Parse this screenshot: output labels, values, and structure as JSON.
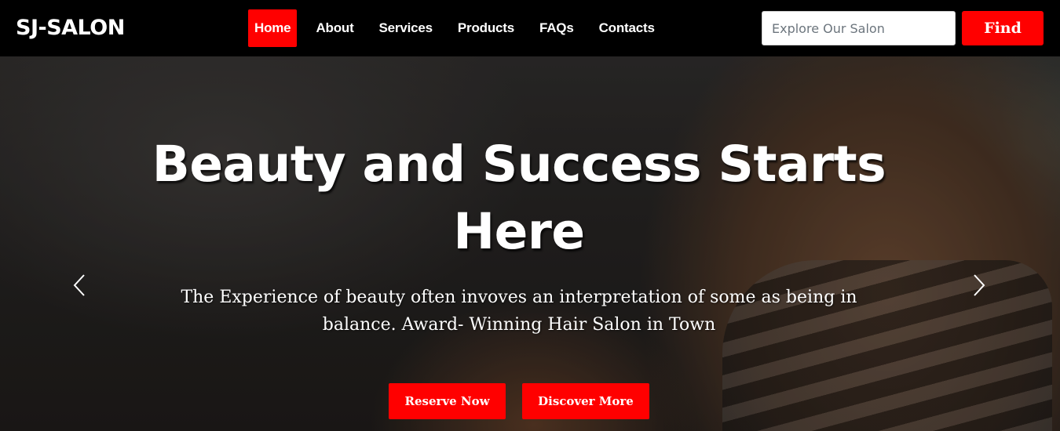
{
  "brand": "SJ-SALON",
  "nav": {
    "items": [
      {
        "label": "Home",
        "active": true
      },
      {
        "label": "About"
      },
      {
        "label": "Services"
      },
      {
        "label": "Products"
      },
      {
        "label": "FAQs"
      },
      {
        "label": "Contacts"
      }
    ]
  },
  "search": {
    "placeholder": "Explore Our Salon",
    "value": "",
    "button_label": "Find"
  },
  "hero": {
    "title": "Beauty and Success Starts Here",
    "text": "The Experience of beauty often invoves an interpretation of some as being in balance. Award- Winning Hair Salon in Town",
    "primary_button": "Reserve Now",
    "secondary_button": "Discover More",
    "prev_icon": "chevron-left-icon",
    "next_icon": "chevron-right-icon"
  },
  "colors": {
    "accent": "#ff0000",
    "navbar_bg": "#000000",
    "text": "#ffffff"
  }
}
